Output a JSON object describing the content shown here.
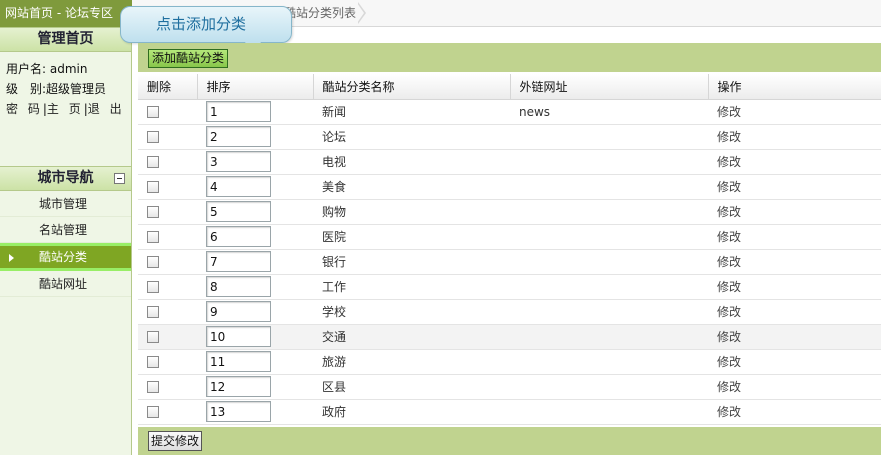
{
  "top_bar": {
    "home_link": "网站首页",
    "separator": " - ",
    "forum_link": "论坛专区",
    "breadcrumb": "酷站分类列表"
  },
  "tooltip": {
    "text": "点击添加分类"
  },
  "sidebar": {
    "admin_header": "管理首页",
    "username_label": "用户名:",
    "username": "admin",
    "level_label": "级　别:",
    "level": "超级管理员",
    "links": [
      "密 码",
      "主 页",
      "退 出"
    ],
    "nav_header": "城市导航",
    "nav_items": [
      {
        "label": "城市管理",
        "active": false
      },
      {
        "label": "名站管理",
        "active": false
      },
      {
        "label": "酷站分类",
        "active": true
      },
      {
        "label": "酷站网址",
        "active": false
      }
    ]
  },
  "toolbar": {
    "add_label": "添加酷站分类"
  },
  "table": {
    "headers": [
      "删除",
      "排序",
      "酷站分类名称",
      "外链网址",
      "操作"
    ],
    "edit_label": "修改",
    "rows": [
      {
        "order": "1",
        "name": "新闻",
        "link": "news"
      },
      {
        "order": "2",
        "name": "论坛",
        "link": ""
      },
      {
        "order": "3",
        "name": "电视",
        "link": ""
      },
      {
        "order": "4",
        "name": "美食",
        "link": ""
      },
      {
        "order": "5",
        "name": "购物",
        "link": ""
      },
      {
        "order": "6",
        "name": "医院",
        "link": ""
      },
      {
        "order": "7",
        "name": "银行",
        "link": ""
      },
      {
        "order": "8",
        "name": "工作",
        "link": ""
      },
      {
        "order": "9",
        "name": "学校",
        "link": ""
      },
      {
        "order": "10",
        "name": "交通",
        "link": ""
      },
      {
        "order": "11",
        "name": "旅游",
        "link": ""
      },
      {
        "order": "12",
        "name": "区县",
        "link": ""
      },
      {
        "order": "13",
        "name": "政府",
        "link": ""
      }
    ]
  },
  "footer": {
    "submit_label": "提交修改"
  }
}
